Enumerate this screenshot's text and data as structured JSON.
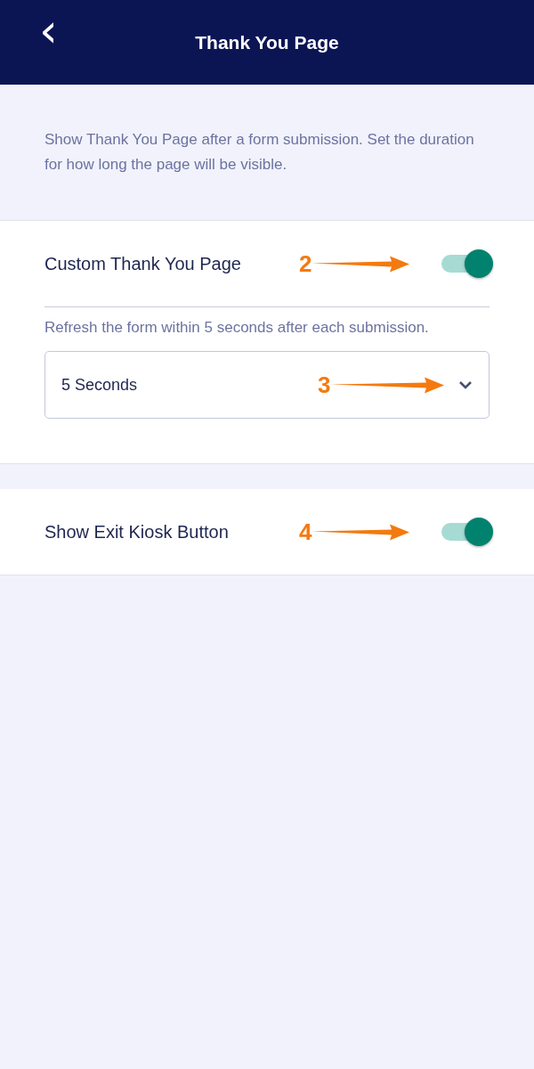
{
  "header": {
    "back": "‹",
    "title": "Thank You Page"
  },
  "description": "Show Thank You Page after a form submission. Set the duration for how long the page will be visible.",
  "cards": [
    {
      "kind": "toggle",
      "label": "Custom Thank You Page",
      "on": true,
      "callout": "2",
      "hint": "Refresh the form within 5 seconds after each submission.",
      "dropdown": {
        "value": "5 Seconds",
        "callout": "3"
      }
    },
    {
      "kind": "toggle",
      "label": "Show Exit Kiosk Button",
      "on": true,
      "callout": "4"
    }
  ]
}
